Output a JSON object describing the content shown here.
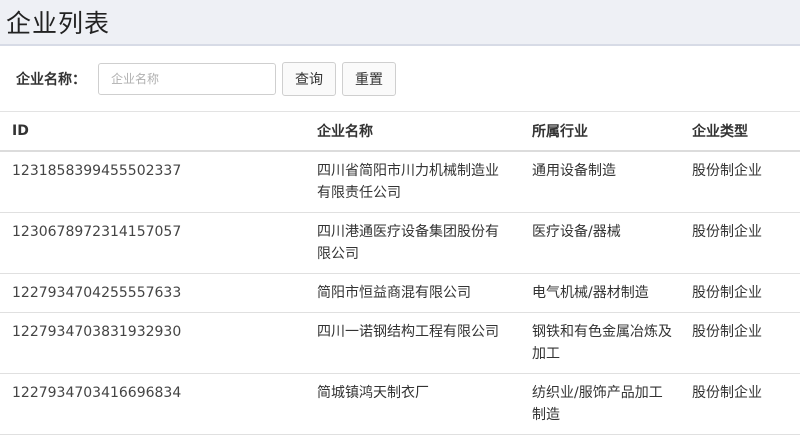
{
  "page": {
    "title": "企业列表"
  },
  "search": {
    "label": "企业名称：",
    "placeholder": "企业名称",
    "value": "",
    "query_button": "查询",
    "reset_button": "重置"
  },
  "table": {
    "headers": [
      "ID",
      "企业名称",
      "所属行业",
      "企业类型"
    ],
    "rows": [
      {
        "id": "1231858399455502337",
        "name": "四川省简阳市川力机械制造业有限责任公司",
        "industry": "通用设备制造",
        "type": "股份制企业"
      },
      {
        "id": "1230678972314157057",
        "name": "四川港通医疗设备集团股份有限公司",
        "industry": "医疗设备/器械",
        "type": "股份制企业"
      },
      {
        "id": "1227934704255557633",
        "name": "简阳市恒益商混有限公司",
        "industry": "电气机械/器材制造",
        "type": "股份制企业"
      },
      {
        "id": "1227934703831932930",
        "name": "四川一诺钢结构工程有限公司",
        "industry": "钢铁和有色金属冶炼及加工",
        "type": "股份制企业"
      },
      {
        "id": "1227934703416696834",
        "name": "简城镇鸿天制衣厂",
        "industry": "纺织业/服饰产品加工制造",
        "type": "股份制企业"
      }
    ]
  }
}
